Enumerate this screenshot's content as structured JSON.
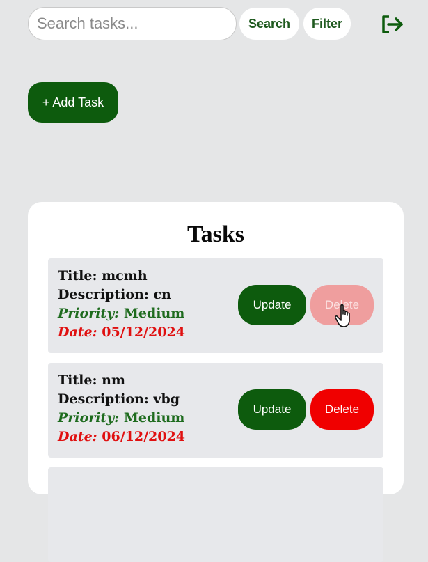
{
  "search": {
    "placeholder": "Search tasks...",
    "value": ""
  },
  "toolbar": {
    "search_label": "Search",
    "filter_label": "Filter",
    "logout_icon": "logout-icon"
  },
  "add_task_label": "+ Add Task",
  "tasks_title": "Tasks",
  "tasks": [
    {
      "title_label": "Title:",
      "title": "mcmh",
      "description_label": "Description:",
      "description": "cn",
      "priority_label": "Priority:",
      "priority": "Medium",
      "date_label": "Date:",
      "date": "05/12/2024",
      "update_label": "Update",
      "delete_label": "Delete"
    },
    {
      "title_label": "Title:",
      "title": "nm",
      "description_label": "Description:",
      "description": "vbg",
      "priority_label": "Priority:",
      "priority": "Medium",
      "date_label": "Date:",
      "date": "06/12/2024",
      "update_label": "Update",
      "delete_label": "Delete"
    }
  ],
  "colors": {
    "brand_green": "#0d5b0d",
    "delete_red": "#f00000",
    "delete_hover": "#ef9e9e",
    "priority_green": "#1e6b1e",
    "date_red": "#e01010",
    "background": "#e5e6e7"
  }
}
